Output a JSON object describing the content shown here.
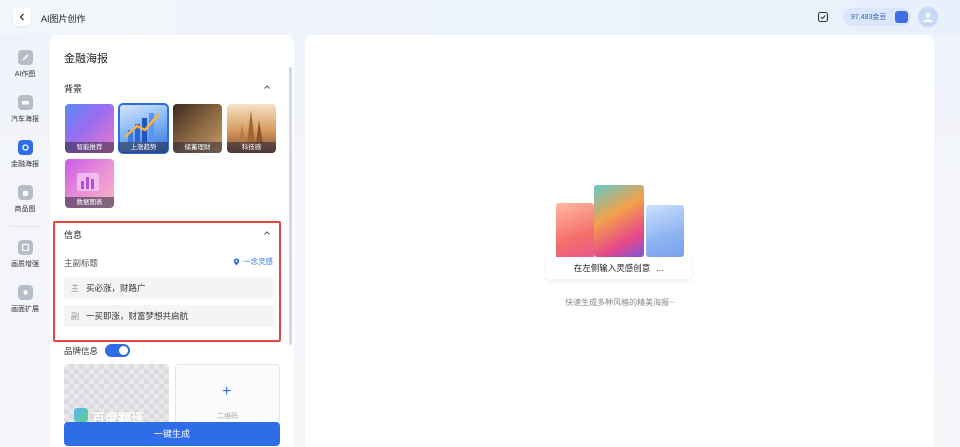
{
  "header": {
    "back_icon": "chevron-left-icon",
    "title": "AI图片创作",
    "checkin_icon": "check-square-icon",
    "balance": "97,483金豆",
    "wallet_icon": "wallet-icon",
    "avatar_icon": "user-avatar-icon"
  },
  "sidebar": {
    "items": [
      {
        "label": "AI作图",
        "icon": "brush-icon",
        "active": false
      },
      {
        "label": "汽车海报",
        "icon": "car-icon",
        "active": false
      },
      {
        "label": "金融海报",
        "icon": "finance-icon",
        "active": true
      },
      {
        "label": "商品图",
        "icon": "bag-icon",
        "active": false
      },
      {
        "label": "画质增强",
        "icon": "enhance-icon",
        "active": false
      },
      {
        "label": "画面扩展",
        "icon": "expand-icon",
        "active": false
      }
    ]
  },
  "panel": {
    "title": "金融海报",
    "background_section": {
      "title": "背景",
      "collapse_icon": "chevron-up-icon",
      "options": [
        {
          "label": "智能推荐",
          "selected": false
        },
        {
          "label": "上涨趋势",
          "selected": true
        },
        {
          "label": "储蓄理财",
          "selected": false
        },
        {
          "label": "科技感",
          "selected": false
        },
        {
          "label": "数据图表",
          "selected": false
        }
      ]
    },
    "info_section": {
      "title": "信息",
      "collapse_icon": "chevron-up-icon",
      "field_label": "主副标题",
      "inspire_label": "一念灵感",
      "inspire_icon": "location-pin-icon",
      "main_prefix": "主",
      "main_value": "买必涨，财路广",
      "sub_prefix": "副",
      "sub_value": "一买即涨，财富梦想共启航"
    },
    "brand_section": {
      "title": "品牌信息",
      "toggle_on": true,
      "logo_text": "百度翻译",
      "upload_caption": "二维码",
      "add_icon": "plus-icon"
    },
    "generate_button": "一键生成"
  },
  "preview": {
    "prompt": "在左侧输入灵感创意",
    "dots": "...",
    "hint": "快速生成多种风格的精美海报~"
  }
}
